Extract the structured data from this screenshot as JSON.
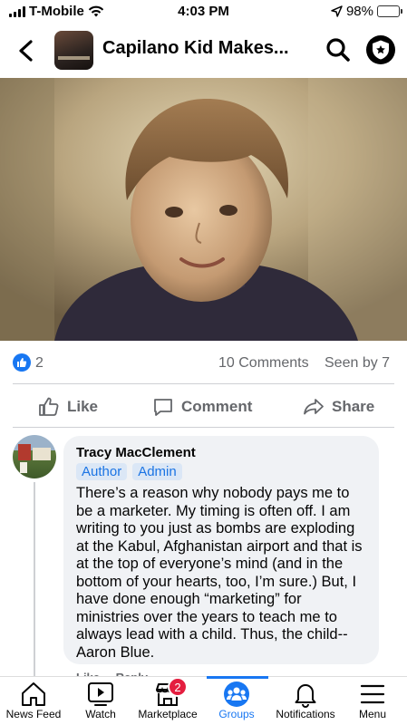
{
  "status_bar": {
    "carrier": "T-Mobile",
    "time": "4:03 PM",
    "battery": "98%"
  },
  "header": {
    "title": "Capilano Kid Makes..."
  },
  "post": {
    "reaction_count": "2",
    "comments": "10 Comments",
    "seen_by": "Seen by 7",
    "actions": {
      "like": "Like",
      "comment": "Comment",
      "share": "Share"
    }
  },
  "comment": {
    "author": "Tracy MacClement",
    "badges": [
      "Author",
      "Admin"
    ],
    "text": "There’s a reason why nobody pays me to be a marketer.  My timing is often off.  I am writing to you just as bombs are exploding at the Kabul, Afghanistan airport and that is at the top of everyone’s mind (and in the bottom of your hearts, too, I’m sure.)  But, I have done enough “marketing” for ministries over the years to teach me to always lead with a child.  Thus, the child--Aaron Blue.",
    "like": "Like",
    "reply": "Reply"
  },
  "tabbar": {
    "items": [
      {
        "label": "News Feed",
        "icon": "home-icon"
      },
      {
        "label": "Watch",
        "icon": "video-icon"
      },
      {
        "label": "Marketplace",
        "icon": "shop-icon",
        "badge": "2"
      },
      {
        "label": "Groups",
        "icon": "groups-icon",
        "active": true
      },
      {
        "label": "Notifications",
        "icon": "bell-icon"
      },
      {
        "label": "Menu",
        "icon": "menu-icon"
      }
    ]
  },
  "colors": {
    "accent": "#1877f2",
    "notification": "#e41e3f",
    "battery": "#34c759",
    "bubble": "#f0f2f5"
  }
}
